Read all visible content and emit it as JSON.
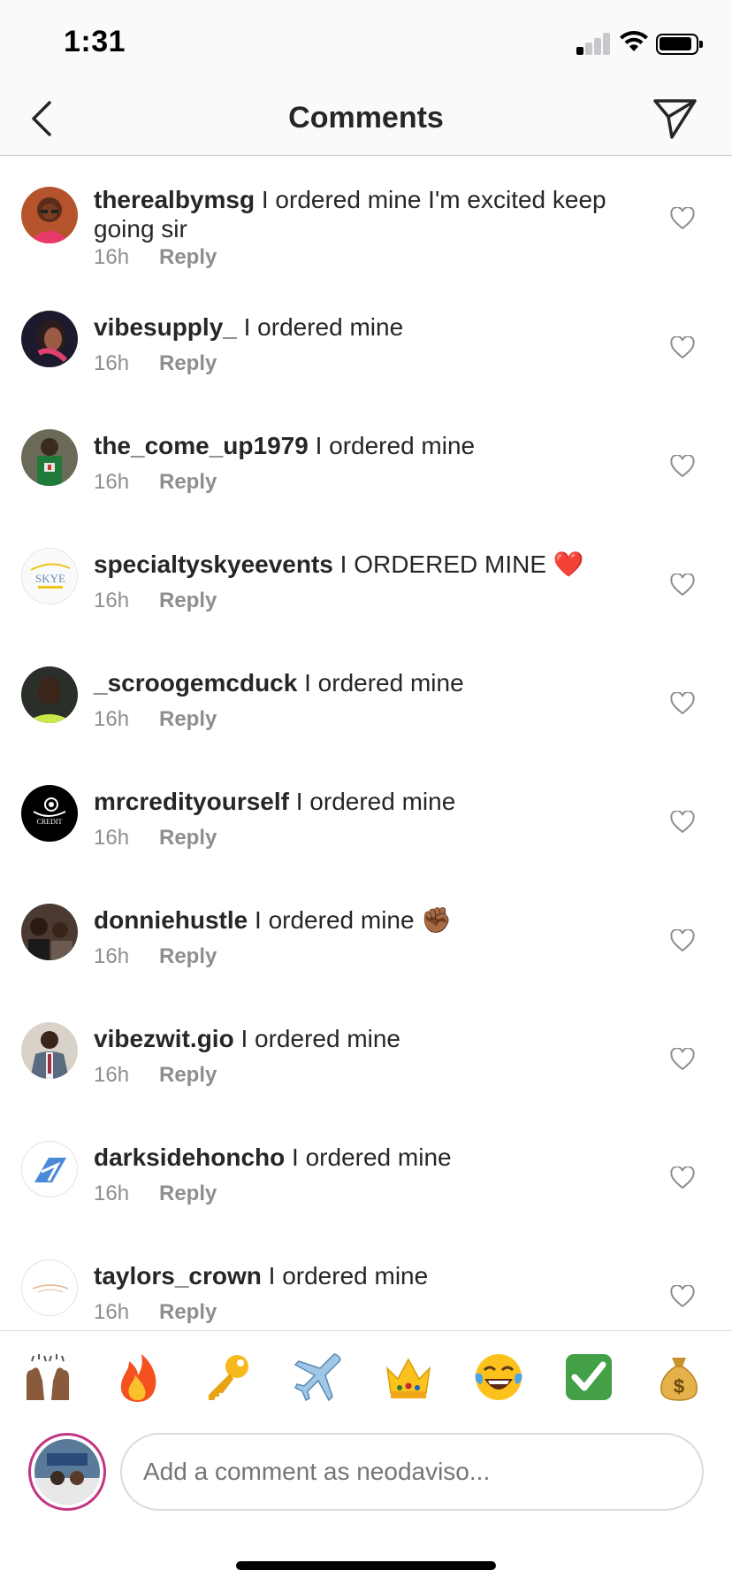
{
  "status_bar": {
    "time": "1:31"
  },
  "header": {
    "title": "Comments"
  },
  "comments": [
    {
      "username": "therealbymsg",
      "text": "I ordered mine I'm excited keep going sir",
      "time": "16h",
      "reply": "Reply"
    },
    {
      "username": "vibesupply_",
      "text": "I ordered mine",
      "time": "16h",
      "reply": "Reply"
    },
    {
      "username": "the_come_up1979",
      "text": "I ordered mine",
      "time": "16h",
      "reply": "Reply"
    },
    {
      "username": "specialtyskyeevents",
      "text": "I ORDERED MINE ❤️",
      "time": "16h",
      "reply": "Reply"
    },
    {
      "username": "_scroogemcduck",
      "text": "I ordered mine",
      "time": "16h",
      "reply": "Reply"
    },
    {
      "username": "mrcredityourself",
      "text": "I ordered mine",
      "time": "16h",
      "reply": "Reply"
    },
    {
      "username": "donniehustle",
      "text": "I ordered mine ✊🏾",
      "time": "16h",
      "reply": "Reply"
    },
    {
      "username": "vibezwit.gio",
      "text": "I ordered mine",
      "time": "16h",
      "reply": "Reply"
    },
    {
      "username": "darksidehoncho",
      "text": "I ordered mine",
      "time": "16h",
      "reply": "Reply"
    },
    {
      "username": "taylors_crown",
      "text": "I ordered mine",
      "time": "16h",
      "reply": "Reply"
    }
  ],
  "avatar_labels": {
    "skye": "SKYE",
    "credit": "CREDIT"
  },
  "emoji_bar": [
    {
      "name": "raising-hands-emoji",
      "char": "🙌🏾"
    },
    {
      "name": "fire-emoji",
      "char": "🔥"
    },
    {
      "name": "key-emoji",
      "char": "🔑"
    },
    {
      "name": "airplane-emoji",
      "char": "✈️"
    },
    {
      "name": "crown-emoji",
      "char": "👑"
    },
    {
      "name": "tears-of-joy-emoji",
      "char": "😂"
    },
    {
      "name": "check-mark-button-emoji",
      "char": "✅"
    },
    {
      "name": "money-bag-emoji",
      "char": "💰"
    }
  ],
  "composer": {
    "placeholder": "Add a comment as neodaviso..."
  },
  "colors": {
    "text": "#262626",
    "secondary": "#8e8e8e",
    "divider": "#dbdbdb",
    "ring": "#c13584",
    "heart": "#e0245e"
  }
}
